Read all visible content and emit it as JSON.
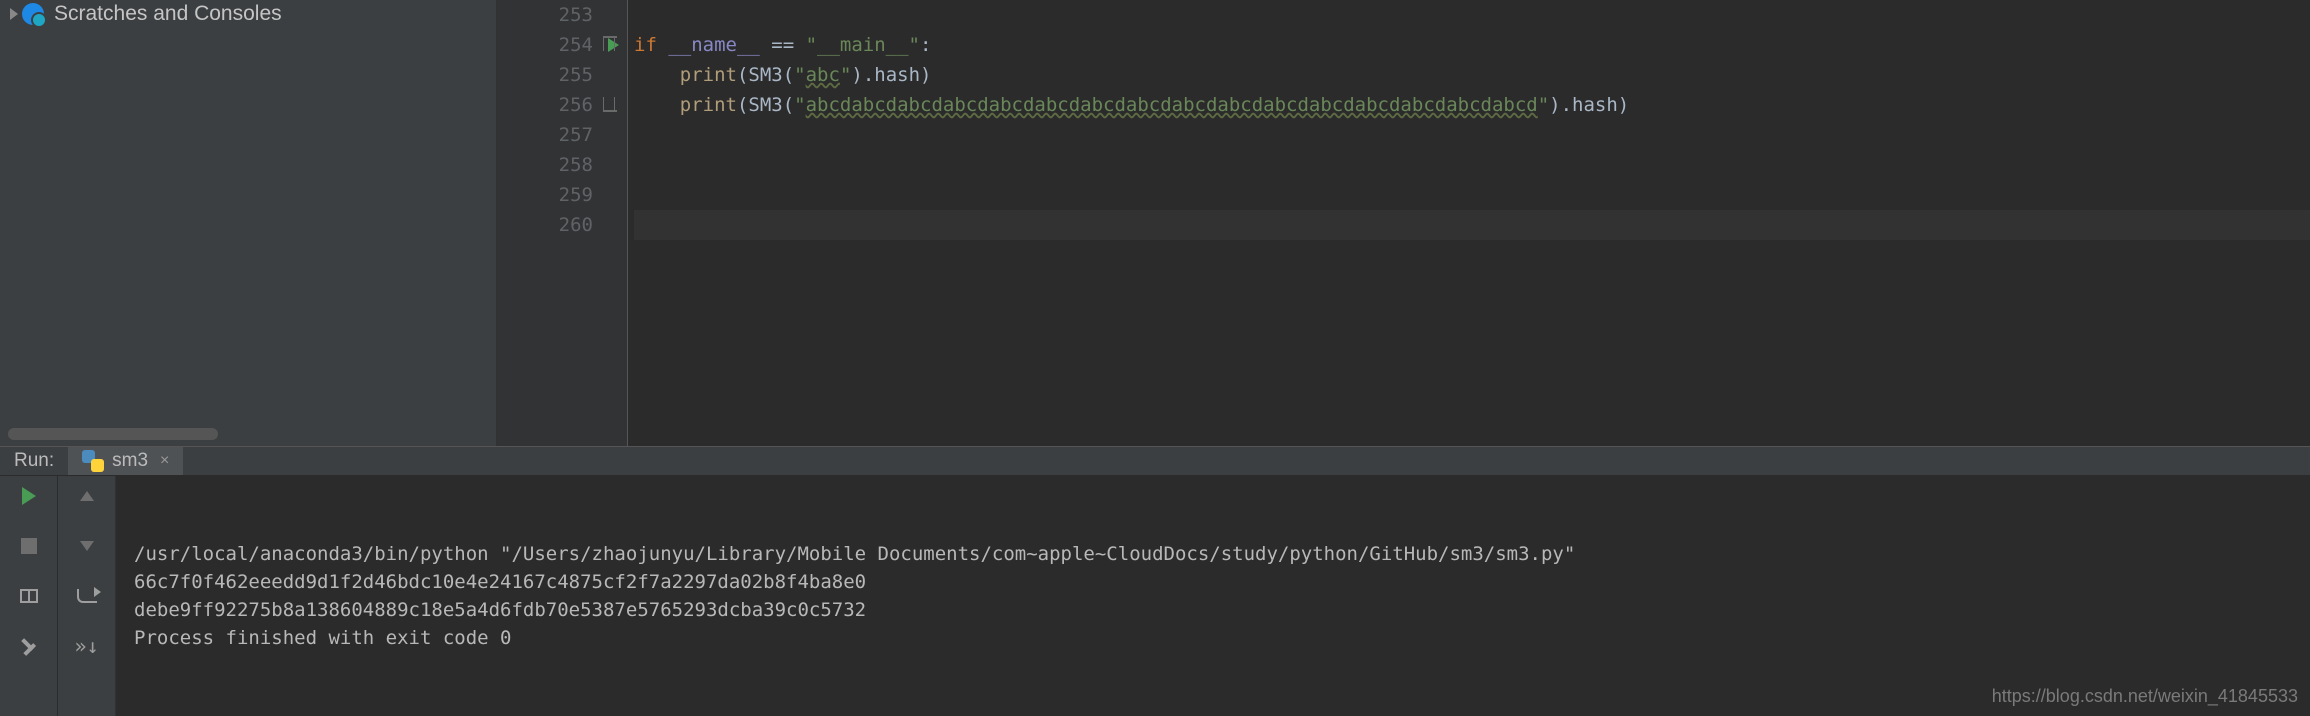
{
  "sidebar": {
    "tree_item": "Scratches and Consoles"
  },
  "editor": {
    "line_start": 253,
    "lines": [
      {
        "n": 253,
        "segments": [
          {
            "t": ""
          }
        ]
      },
      {
        "n": 254,
        "run": true,
        "fold": "open",
        "segments": [
          {
            "t": "if ",
            "c": "kw"
          },
          {
            "t": "__name__",
            "c": "builtin"
          },
          {
            "t": " == "
          },
          {
            "t": "\"__main__\"",
            "c": "str"
          },
          {
            "t": ":"
          }
        ]
      },
      {
        "n": 255,
        "segments": [
          {
            "t": "    print",
            "c": "call"
          },
          {
            "t": "(SM3("
          },
          {
            "t": "\"",
            "c": "str"
          },
          {
            "t": "abc",
            "c": "str underl"
          },
          {
            "t": "\"",
            "c": "str"
          },
          {
            "t": ").hash)"
          }
        ]
      },
      {
        "n": 256,
        "fold": "close",
        "segments": [
          {
            "t": "    print",
            "c": "call"
          },
          {
            "t": "(SM3("
          },
          {
            "t": "\"",
            "c": "str"
          },
          {
            "t": "abcdabcdabcdabcdabcdabcdabcdabcdabcdabcdabcdabcdabcdabcdabcdabcd",
            "c": "str underl"
          },
          {
            "t": "\"",
            "c": "str"
          },
          {
            "t": ").hash)"
          }
        ]
      },
      {
        "n": 257,
        "segments": [
          {
            "t": ""
          }
        ]
      },
      {
        "n": 258,
        "segments": [
          {
            "t": ""
          }
        ]
      },
      {
        "n": 259,
        "segments": [
          {
            "t": ""
          }
        ]
      },
      {
        "n": 260,
        "current": true,
        "segments": [
          {
            "t": ""
          }
        ]
      }
    ]
  },
  "run": {
    "label": "Run:",
    "tab_name": "sm3",
    "output": [
      "/usr/local/anaconda3/bin/python \"/Users/zhaojunyu/Library/Mobile Documents/com~apple~CloudDocs/study/python/GitHub/sm3/sm3.py\"",
      "66c7f0f462eeedd9d1f2d46bdc10e4e24167c4875cf2f7a2297da02b8f4ba8e0",
      "debe9ff92275b8a138604889c18e5a4d6fdb70e5387e5765293dcba39c0c5732",
      "",
      "Process finished with exit code 0"
    ]
  },
  "watermark": "https://blog.csdn.net/weixin_41845533"
}
